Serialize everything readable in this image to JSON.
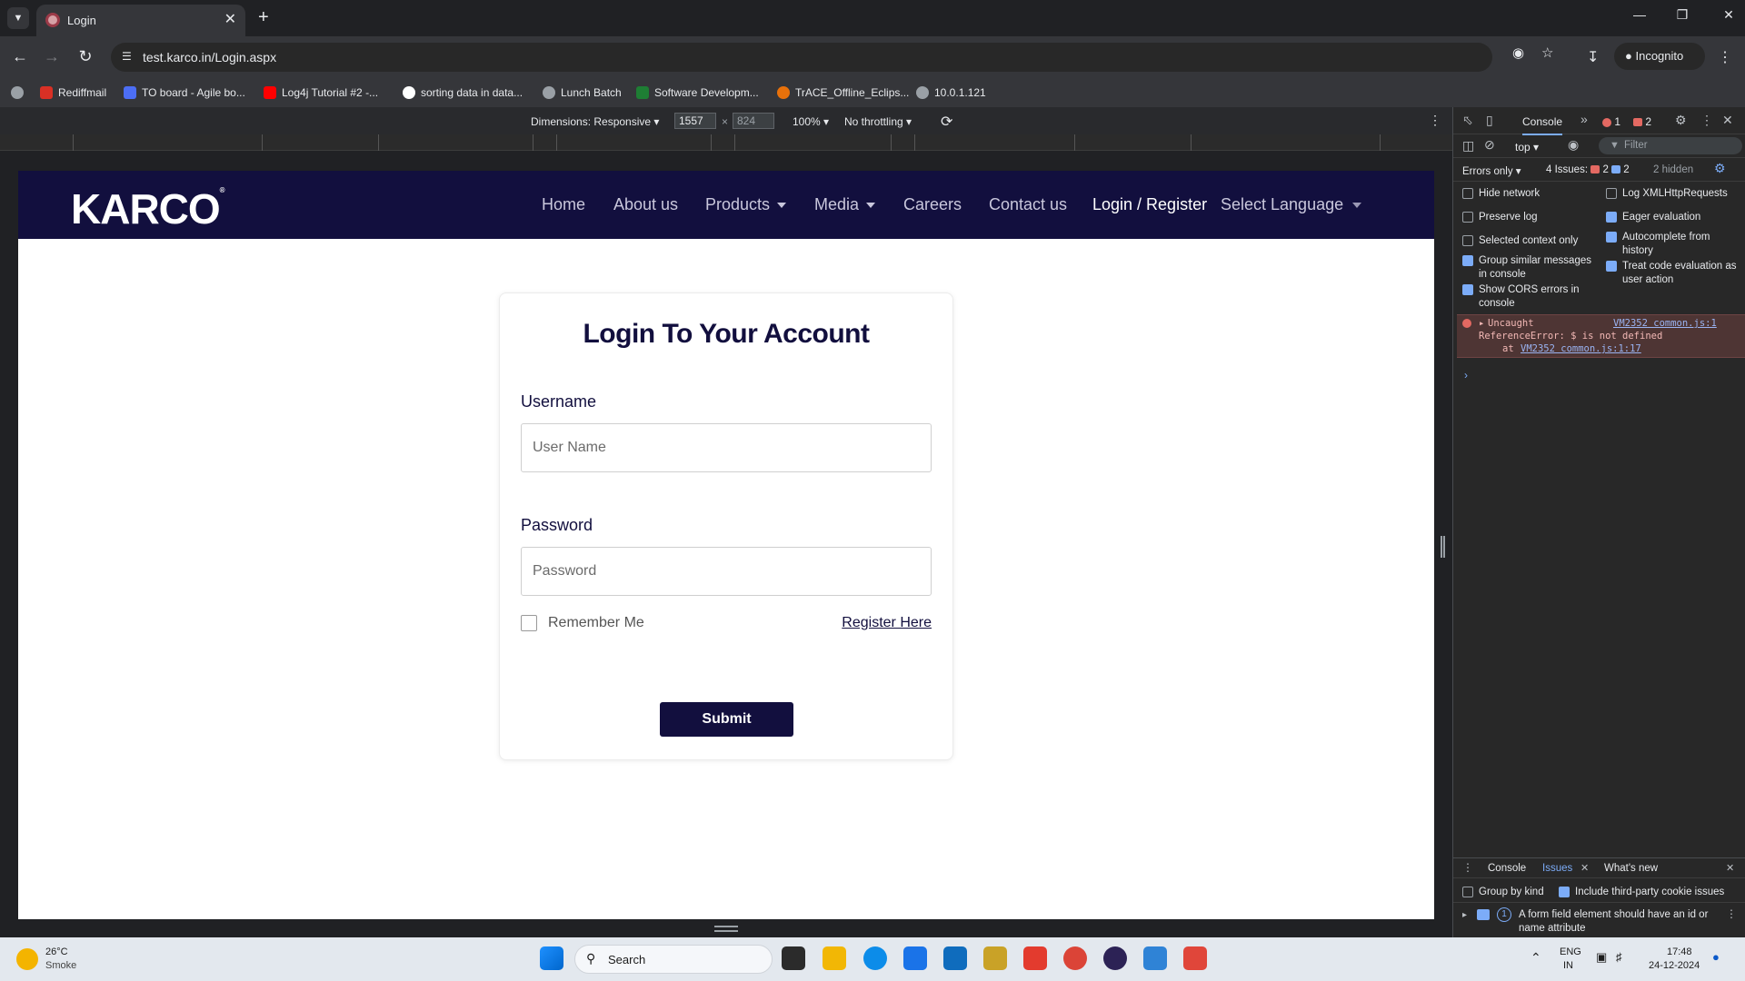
{
  "browser": {
    "tab_title": "Login",
    "url": "test.karco.in/Login.aspx",
    "incognito_label": "Incognito",
    "bookmarks": [
      {
        "label": "Rediffmail",
        "color": "#d93025"
      },
      {
        "label": "TO board - Agile bo...",
        "color": "#4c6ef5"
      },
      {
        "label": "Log4j Tutorial #2 -...",
        "color": "#ff0000"
      },
      {
        "label": "sorting data in data...",
        "color": "#ffffff"
      },
      {
        "label": "Lunch Batch",
        "color": "#9aa0a6"
      },
      {
        "label": "Software Developm...",
        "color": "#1e7e34"
      },
      {
        "label": "TrACE_Offline_Eclips...",
        "color": "#e8710a"
      },
      {
        "label": "10.0.1.121",
        "color": "#9aa0a6"
      }
    ]
  },
  "device_toolbar": {
    "dimensions_label": "Dimensions: Responsive",
    "width": "1557",
    "height": "824",
    "zoom": "100%",
    "throttling": "No throttling"
  },
  "site": {
    "logo": "KARCO",
    "logo_mark": "®",
    "nav": [
      {
        "label": "Home",
        "dropdown": false,
        "active": false
      },
      {
        "label": "About us",
        "dropdown": false,
        "active": false
      },
      {
        "label": "Products",
        "dropdown": true,
        "active": false
      },
      {
        "label": "Media",
        "dropdown": true,
        "active": false
      },
      {
        "label": "Careers",
        "dropdown": false,
        "active": false
      },
      {
        "label": "Contact us",
        "dropdown": false,
        "active": false
      },
      {
        "label": "Login / Register",
        "dropdown": false,
        "active": true
      }
    ],
    "language": "Select Language",
    "colors": {
      "brand": "#120f3e"
    }
  },
  "login": {
    "heading": "Login To Your Account",
    "username_label": "Username",
    "username_placeholder": "User Name",
    "password_label": "Password",
    "password_placeholder": "Password",
    "remember_label": "Remember Me",
    "remember_checked": false,
    "register_link": "Register Here",
    "submit_label": "Submit"
  },
  "devtools": {
    "tabs": [
      "Console"
    ],
    "error_count": "1",
    "warn_count": "2",
    "context": "top",
    "filter_placeholder": "Filter",
    "level": "Errors only",
    "issues_label": "4 Issues:",
    "issues_err": "2",
    "issues_info": "2",
    "hidden": "2 hidden",
    "options_left": [
      {
        "label": "Hide network",
        "checked": false
      },
      {
        "label": "Preserve log",
        "checked": false
      },
      {
        "label": "Selected context only",
        "checked": false
      },
      {
        "label": "Group similar messages in console",
        "checked": true
      },
      {
        "label": "Show CORS errors in console",
        "checked": true
      }
    ],
    "options_right": [
      {
        "label": "Log XMLHttpRequests",
        "checked": false
      },
      {
        "label": "Eager evaluation",
        "checked": true
      },
      {
        "label": "Autocomplete from history",
        "checked": true
      },
      {
        "label": "Treat code evaluation as user action",
        "checked": true
      }
    ],
    "error_line1": "Uncaught",
    "error_source": "VM2352 common.js:1",
    "error_line2": "ReferenceError: $ is not defined",
    "error_line3_prefix": "at",
    "error_line3_link": "VM2352 common.js:1:17",
    "drawer_tabs": [
      "Console",
      "Issues",
      "What's new"
    ],
    "group_by_kind": "Group by kind",
    "include_third_party": "Include third-party cookie issues",
    "issue_count": "1",
    "issue_text": "A form field element should have an id or name attribute"
  },
  "taskbar": {
    "temp": "26°C",
    "weather": "Smoke",
    "search": "Search",
    "lang1": "ENG",
    "lang2": "IN",
    "time": "17:48",
    "date": "24-12-2024"
  }
}
